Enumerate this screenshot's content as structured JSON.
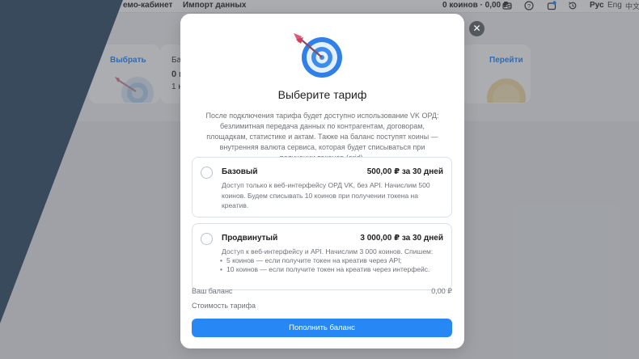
{
  "topbar": {
    "nav_items": [
      "емо-кабинет",
      "Импорт данных"
    ],
    "coins": "0 коинов · 0,00 ₽",
    "languages": [
      "Рус",
      "Eng",
      "中文"
    ]
  },
  "cards": {
    "card1_link": "Выбрать",
    "card2_lines": [
      "Ба",
      "0 к",
      "1 к"
    ],
    "card3_link": "Перейти"
  },
  "modal": {
    "close_label": "✕",
    "title": "Выберите тариф",
    "description": "После подключения тарифа будет доступно использование VK ОРД: безлимитная передача данных по контрагентам, договорам, площадкам, статистике и актам. Также на баланс поступят коины — внутренняя валюта сервиса, которая будет списываться при получении токенов (erid).",
    "plans": [
      {
        "name": "Базовый",
        "price": "500,00 ₽ за 30 дней",
        "description": "Доступ только к веб-интерфейсу ОРД VK, без API. Начислим 500 коинов. Будем списывать 10 коинов при получении токена на креатив."
      },
      {
        "name": "Продвинутый",
        "price": "3 000,00 ₽ за 30 дней",
        "description": "Доступ к веб-интерфейсу и API. Начислим 3 000 коинов. Спишем:",
        "bullets": [
          "5 коинов — если получите токен на креатив через API;",
          "10 коинов — если получите токен на креатив через интерфейс."
        ]
      }
    ],
    "balance_label": "Ваш баланс",
    "balance_value": "0,00 ₽",
    "cost_label": "Стоимость тарифа",
    "topup_button": "Пополнить баланс"
  },
  "colors": {
    "accent": "#2787f5",
    "overlay": "#464a50",
    "sidebar_dark": "#2f4b68"
  },
  "icons": [
    "wallet-icon",
    "help-icon",
    "notification-icon",
    "history-icon",
    "target-icon",
    "close-icon"
  ]
}
